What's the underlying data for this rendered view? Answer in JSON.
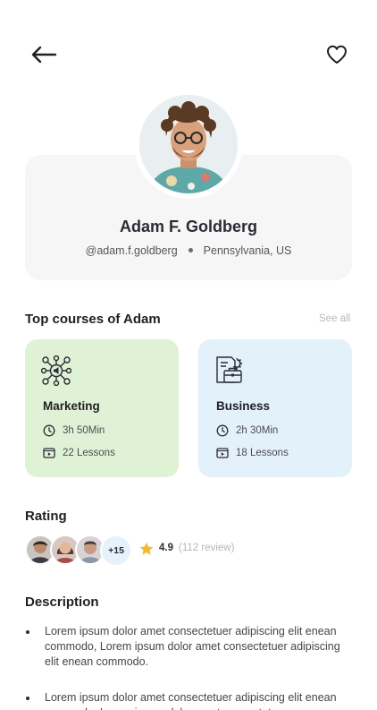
{
  "profile": {
    "name": "Adam F. Goldberg",
    "handle": "@adam.f.goldberg",
    "location": "Pennsylvania, US"
  },
  "courses_section": {
    "title": "Top courses of Adam",
    "see_all": "See all",
    "items": [
      {
        "title": "Marketing",
        "duration": "3h 50Min",
        "lessons": "22 Lessons",
        "icon": "marketing-network-icon",
        "color": "#dff2d6"
      },
      {
        "title": "Business",
        "duration": "2h 30Min",
        "lessons": "18 Lessons",
        "icon": "briefcase-document-icon",
        "color": "#e3f1fb"
      }
    ]
  },
  "rating": {
    "title": "Rating",
    "extra_count": "+15",
    "score": "4.9",
    "reviews": "(112 review)",
    "star_color": "#f5b82e"
  },
  "description": {
    "title": "Description",
    "items": [
      "Lorem ipsum dolor amet consectetuer adipiscing elit enean commodo, Lorem ipsum dolor amet consectetuer adipiscing elit enean commodo.",
      "Lorem ipsum dolor amet consectetuer adipiscing elit enean commodo, Lorem ipsum dolor amet consectetuer"
    ]
  }
}
